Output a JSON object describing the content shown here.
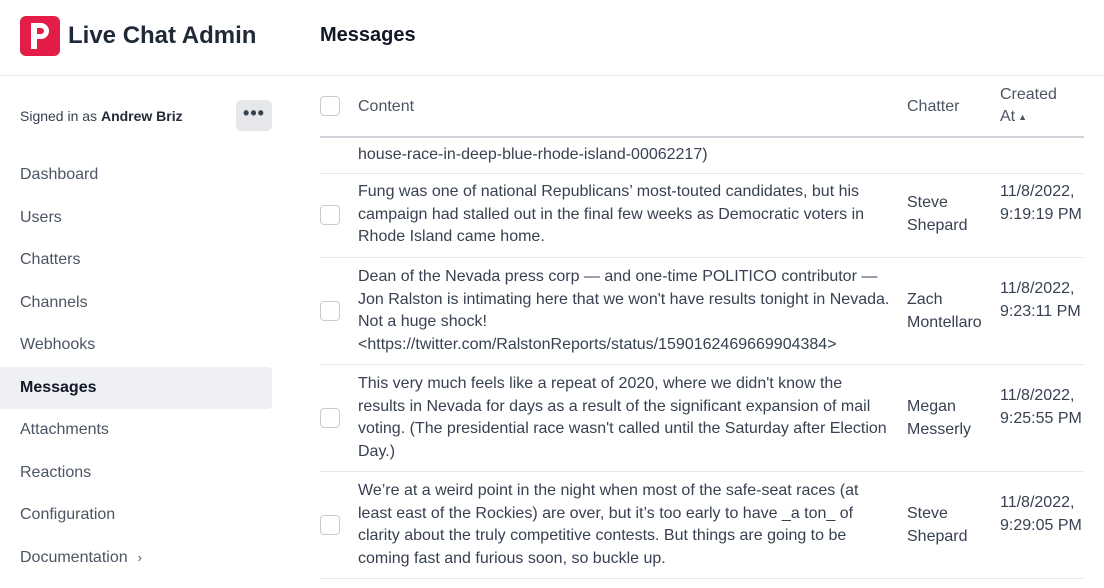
{
  "app": {
    "title": "Live Chat Admin",
    "logo_letter": "P",
    "brand_color": "#e11d48"
  },
  "page": {
    "title": "Messages"
  },
  "sidebar": {
    "signed_in_prefix": "Signed in as",
    "user_name": "Andrew Briz",
    "more_label": "•••",
    "items": [
      {
        "label": "Dashboard"
      },
      {
        "label": "Users"
      },
      {
        "label": "Chatters"
      },
      {
        "label": "Channels"
      },
      {
        "label": "Webhooks"
      },
      {
        "label": "Messages",
        "active": true
      },
      {
        "label": "Attachments"
      },
      {
        "label": "Reactions"
      },
      {
        "label": "Configuration"
      },
      {
        "label": "Documentation",
        "chevron": "›"
      }
    ]
  },
  "table": {
    "columns": {
      "content": "Content",
      "chatter": "Chatter",
      "created": "Created At",
      "sort_indicator": "▲"
    },
    "partial_row": {
      "content": "house-race-in-deep-blue-rhode-island-00062217)"
    },
    "rows": [
      {
        "content": "Fung was one of national Republicans’ most-touted candidates, but his campaign had stalled out in the final few weeks as Democratic voters in Rhode Island came home.",
        "chatter": "Steve Shepard",
        "created": "11/8/2022, 9:19:19 PM"
      },
      {
        "content": "Dean of the Nevada press corp — and one-time POLITICO contributor — Jon Ralston is intimating here that we won't have results tonight in Nevada. Not a huge shock! <https://twitter.com/RalstonReports/status/1590162469669904384>",
        "chatter": "Zach Montellaro",
        "created": "11/8/2022, 9:23:11 PM"
      },
      {
        "content": "This very much feels like a repeat of 2020, where we didn't know the results in Nevada for days as a result of the significant expansion of mail voting. (The presidential race wasn't called until the Saturday after Election Day.)",
        "chatter": "Megan Messerly",
        "created": "11/8/2022, 9:25:55 PM"
      },
      {
        "content": "We’re at a weird point in the night when most of the safe-seat races (at least east of the Rockies) are over, but it’s too early to have _a ton_ of clarity about the truly competitive contests. But things are going to be coming fast and furious soon, so buckle up.",
        "chatter": "Steve Shepard",
        "created": "11/8/2022, 9:29:05 PM"
      }
    ]
  }
}
